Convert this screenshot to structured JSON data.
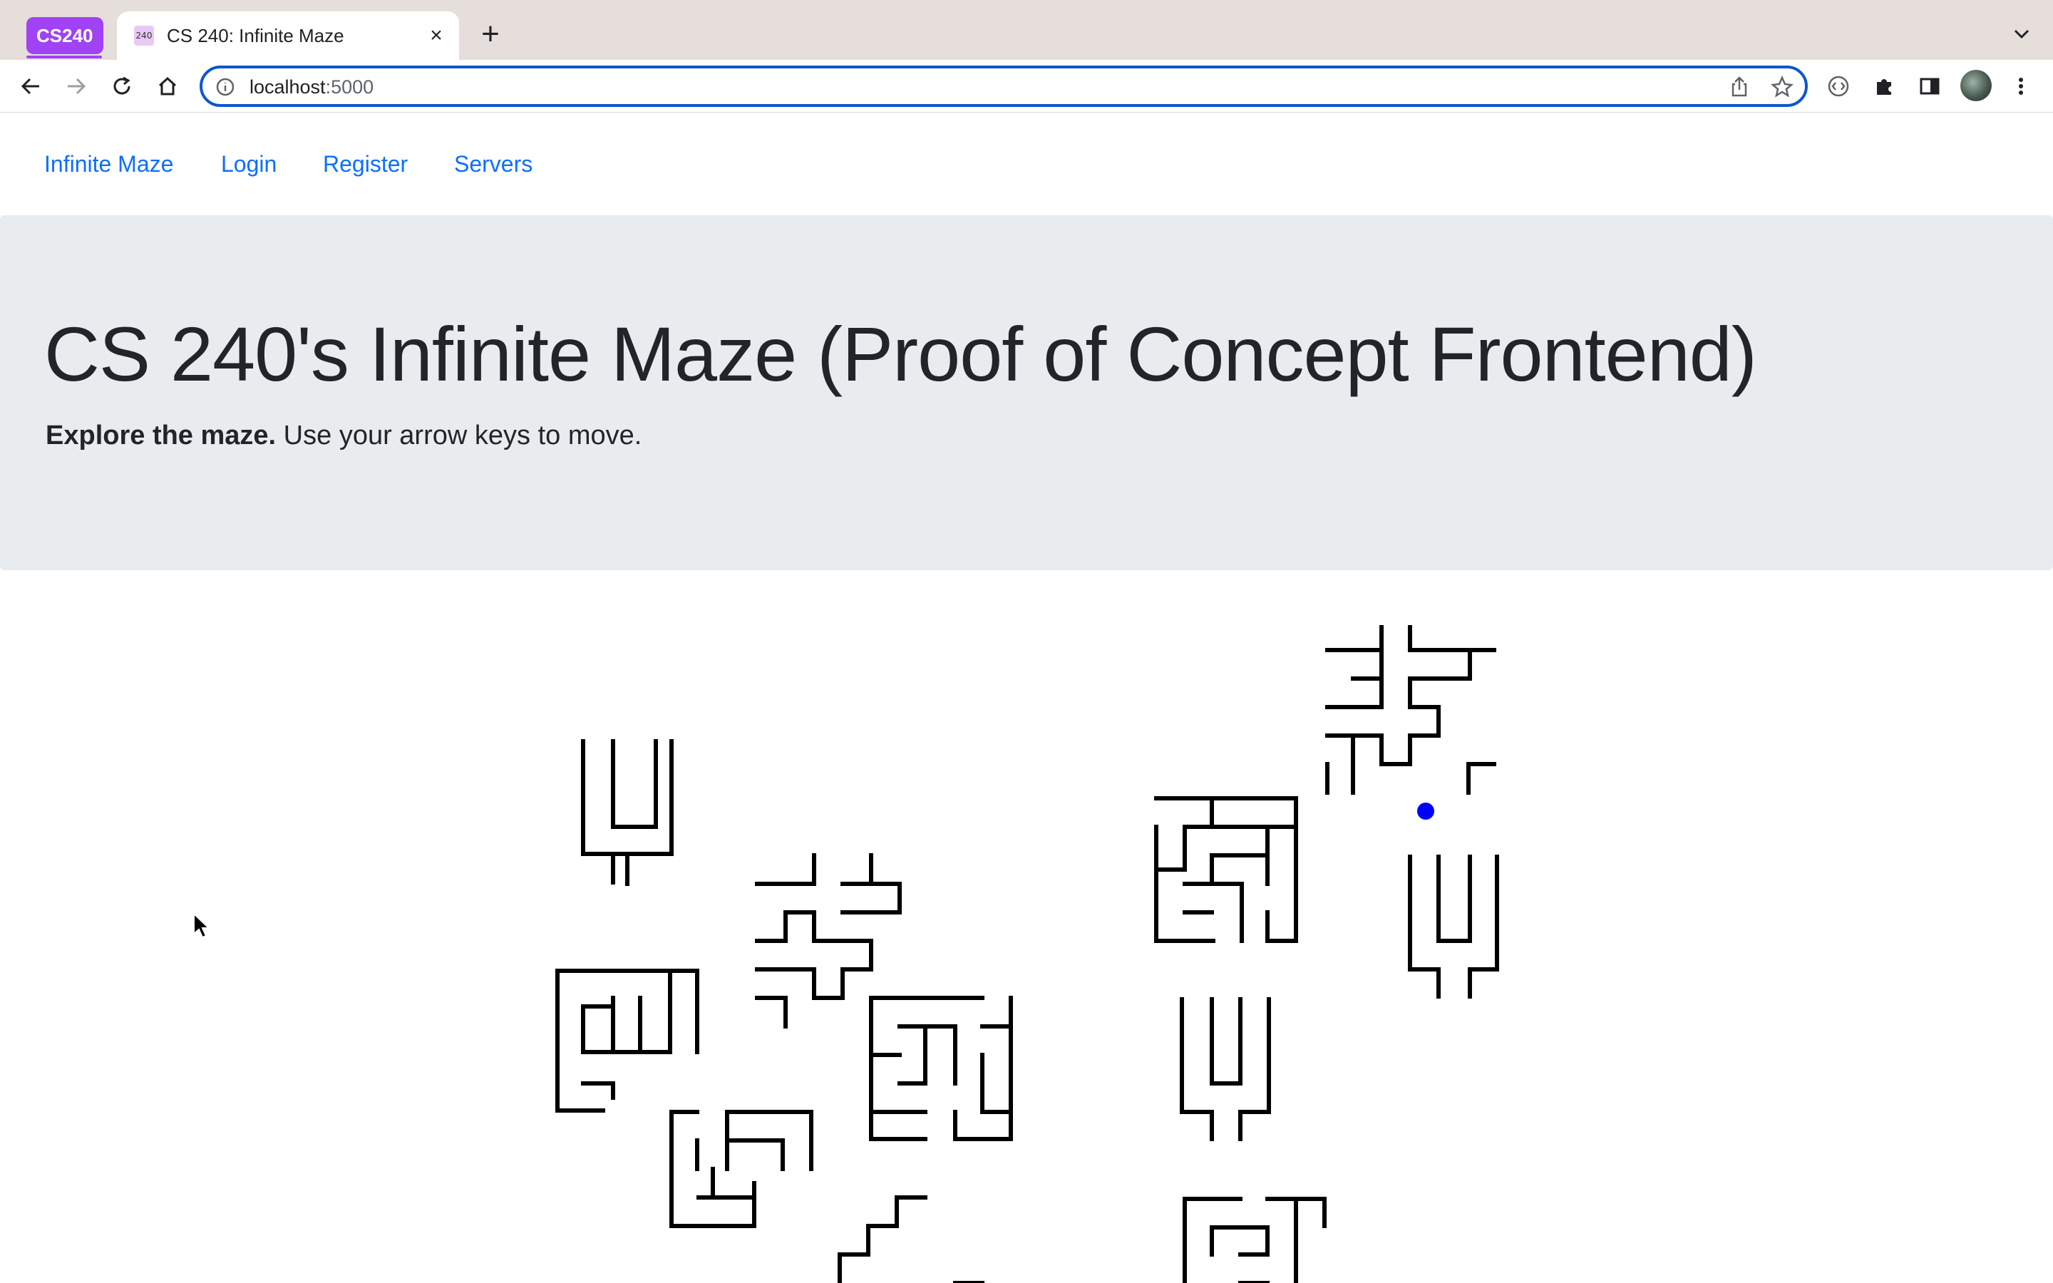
{
  "browser": {
    "tab_group_label": "CS240",
    "tab_favicon_text": "240",
    "tab_title": "CS 240: Infinite Maze",
    "url_host": "localhost",
    "url_port": ":5000",
    "tab_close_glyph": "×",
    "new_tab_glyph": "+",
    "icons": [
      "back-arrow-icon",
      "forward-arrow-icon",
      "reload-icon",
      "home-icon",
      "info-icon",
      "share-icon",
      "star-icon",
      "code-icon",
      "extensions-icon",
      "sidepanel-icon",
      "kebab-menu-icon"
    ],
    "accent_color": "#0b57d0",
    "group_color": "#a142f4"
  },
  "nav": {
    "brand": "Infinite Maze",
    "links": [
      "Login",
      "Register",
      "Servers"
    ],
    "link_color": "#0d6efd"
  },
  "hero": {
    "title": "CS 240's Infinite Maze (Proof of Concept Frontend)",
    "lead_bold": "Explore the maze.",
    "lead_rest": " Use your arrow keys to move."
  },
  "maze": {
    "wall_color": "#000000",
    "player_color": "#0000ff"
  }
}
